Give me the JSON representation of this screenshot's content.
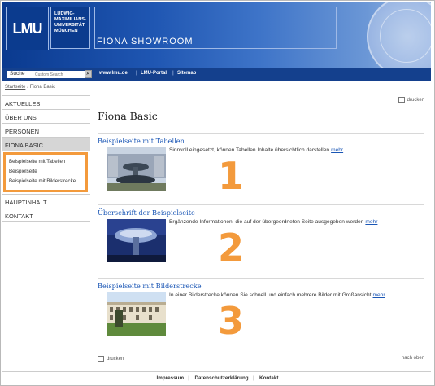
{
  "header": {
    "logo_text": "LMU",
    "university_lines": [
      "LUDWIG-",
      "MAXIMILIANS-",
      "UNIVERSITÄT",
      "MÜNCHEN"
    ],
    "site_title": "FIONA SHOWROOM"
  },
  "navbar": {
    "search_label": "Suche",
    "search_placeholder": "Custom Search",
    "links": [
      "www.lmu.de",
      "LMU-Portal",
      "Sitemap"
    ]
  },
  "breadcrumb": {
    "home": "Startseite",
    "separator": "›",
    "current": "Fiona Basic"
  },
  "sidebar": {
    "items_top": [
      "AKTUELLES",
      "ÜBER UNS",
      "PERSONEN",
      "FIONA BASIC"
    ],
    "submenu": [
      "Beispielseite mit Tabellen",
      "Beispielseite",
      "Beispielseite mit Bilderstrecke"
    ],
    "items_bottom": [
      "HAUPTINHALT",
      "KONTAKT"
    ]
  },
  "main": {
    "print_label": "drucken",
    "title": "Fiona Basic",
    "sections": [
      {
        "heading": "Beispielseite mit Tabellen",
        "text": "Sinnvoll eingesetzt, können Tabellen Inhalte übersichtlich darstellen",
        "more": "mehr",
        "number": "1"
      },
      {
        "heading": "Überschrift der Beispielseite",
        "text": "Ergänzende Informationen, die auf der übergeordneten Seite ausgegeben werden",
        "more": "mehr",
        "number": "2"
      },
      {
        "heading": "Beispielseite mit Bilderstrecke",
        "text": "In einer Bilderstrecke können Sie schnell und einfach mehrere Bilder mit Großansicht",
        "more": "mehr",
        "number": "3"
      }
    ],
    "bottom_print": "drucken",
    "back_to_top": "nach oben"
  },
  "footer": {
    "links": [
      "Impressum",
      "Datenschutzerklärung",
      "Kontakt"
    ]
  },
  "colors": {
    "accent_orange": "#f39a3c",
    "link_blue": "#1a56b5",
    "header_blue": "#14408d"
  }
}
